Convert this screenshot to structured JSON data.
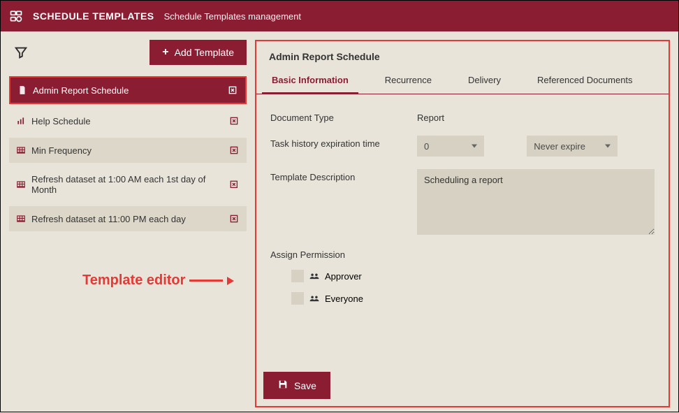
{
  "header": {
    "title": "SCHEDULE TEMPLATES",
    "subtitle": "Schedule Templates management"
  },
  "left": {
    "add_label": "Add Template",
    "items": [
      {
        "label": "Admin Report Schedule",
        "icon": "doc"
      },
      {
        "label": "Help Schedule",
        "icon": "chart"
      },
      {
        "label": "Min Frequency",
        "icon": "grid"
      },
      {
        "label": "Refresh dataset at 1:00 AM each 1st day of Month",
        "icon": "grid"
      },
      {
        "label": "Refresh dataset at 11:00 PM each day",
        "icon": "grid"
      }
    ]
  },
  "annotation": {
    "text": "Template editor"
  },
  "editor": {
    "title": "Admin Report Schedule",
    "tabs": {
      "basic": "Basic Information",
      "recurrence": "Recurrence",
      "delivery": "Delivery",
      "refdocs": "Referenced Documents"
    },
    "fields": {
      "doc_type_label": "Document Type",
      "doc_type_value": "Report",
      "expiry_label": "Task history expiration time",
      "expiry_value": "0",
      "expiry_unit": "Never expire",
      "desc_label": "Template Description",
      "desc_value": "Scheduling a report",
      "perm_label": "Assign Permission",
      "perm_items": {
        "approver": "Approver",
        "everyone": "Everyone"
      }
    },
    "save_label": "Save"
  }
}
